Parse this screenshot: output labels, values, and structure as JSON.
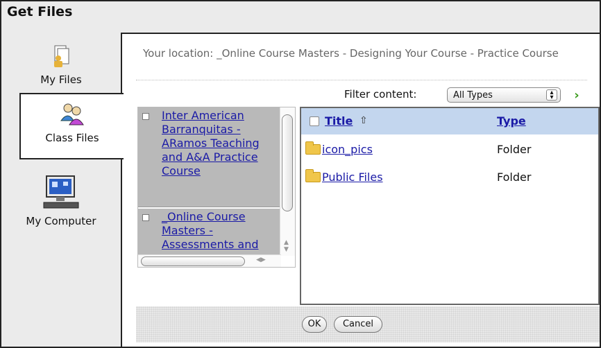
{
  "dialog": {
    "title": "Get Files"
  },
  "sidebar": {
    "tabs": [
      {
        "label": "My Files",
        "icon": "my-files-icon",
        "selected": false
      },
      {
        "label": "Class Files",
        "icon": "class-files-icon",
        "selected": true
      },
      {
        "label": "My Computer",
        "icon": "computer-icon",
        "selected": false
      }
    ]
  },
  "location": {
    "text": "Your location: _Online Course Masters - Designing Your Course - Practice Course"
  },
  "filter": {
    "label": "Filter content:",
    "selected": "All Types",
    "go_icon": "chevron-right-icon"
  },
  "tree": {
    "items": [
      {
        "label": "Inter American Barranquitas - ARamos Teaching and A&A Practice Course"
      },
      {
        "label": "_Online Course Masters - Assessments and"
      }
    ]
  },
  "filelist": {
    "columns": {
      "title": "Title",
      "type": "Type"
    },
    "sort_icon": "⇧",
    "rows": [
      {
        "name": "icon_pics",
        "type": "Folder"
      },
      {
        "name": "Public Files",
        "type": "Folder"
      }
    ]
  },
  "footer": {
    "ok_label": "OK",
    "cancel_label": "Cancel"
  },
  "colors": {
    "header_bg": "#c3d6ee",
    "link": "#1a1aa6",
    "go_green": "#3a9a1c",
    "folder": "#f0c64a"
  }
}
